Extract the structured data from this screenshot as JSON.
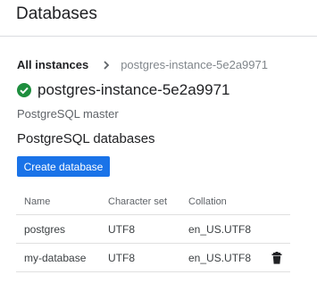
{
  "page": {
    "title": "Databases"
  },
  "breadcrumb": {
    "root": "All instances",
    "current": "postgres-instance-5e2a9971"
  },
  "instance": {
    "name": "postgres-instance-5e2a9971",
    "type": "PostgreSQL master",
    "status_icon": "check-circle-icon",
    "status_color": "#1e8e3e"
  },
  "section": {
    "title": "PostgreSQL databases"
  },
  "actions": {
    "create_label": "Create database",
    "accent": "#1a73e8"
  },
  "table": {
    "columns": [
      "Name",
      "Character set",
      "Collation"
    ],
    "rows": [
      {
        "name": "postgres",
        "charset": "UTF8",
        "collation": "en_US.UTF8",
        "deletable": false
      },
      {
        "name": "my-database",
        "charset": "UTF8",
        "collation": "en_US.UTF8",
        "deletable": true
      }
    ]
  }
}
